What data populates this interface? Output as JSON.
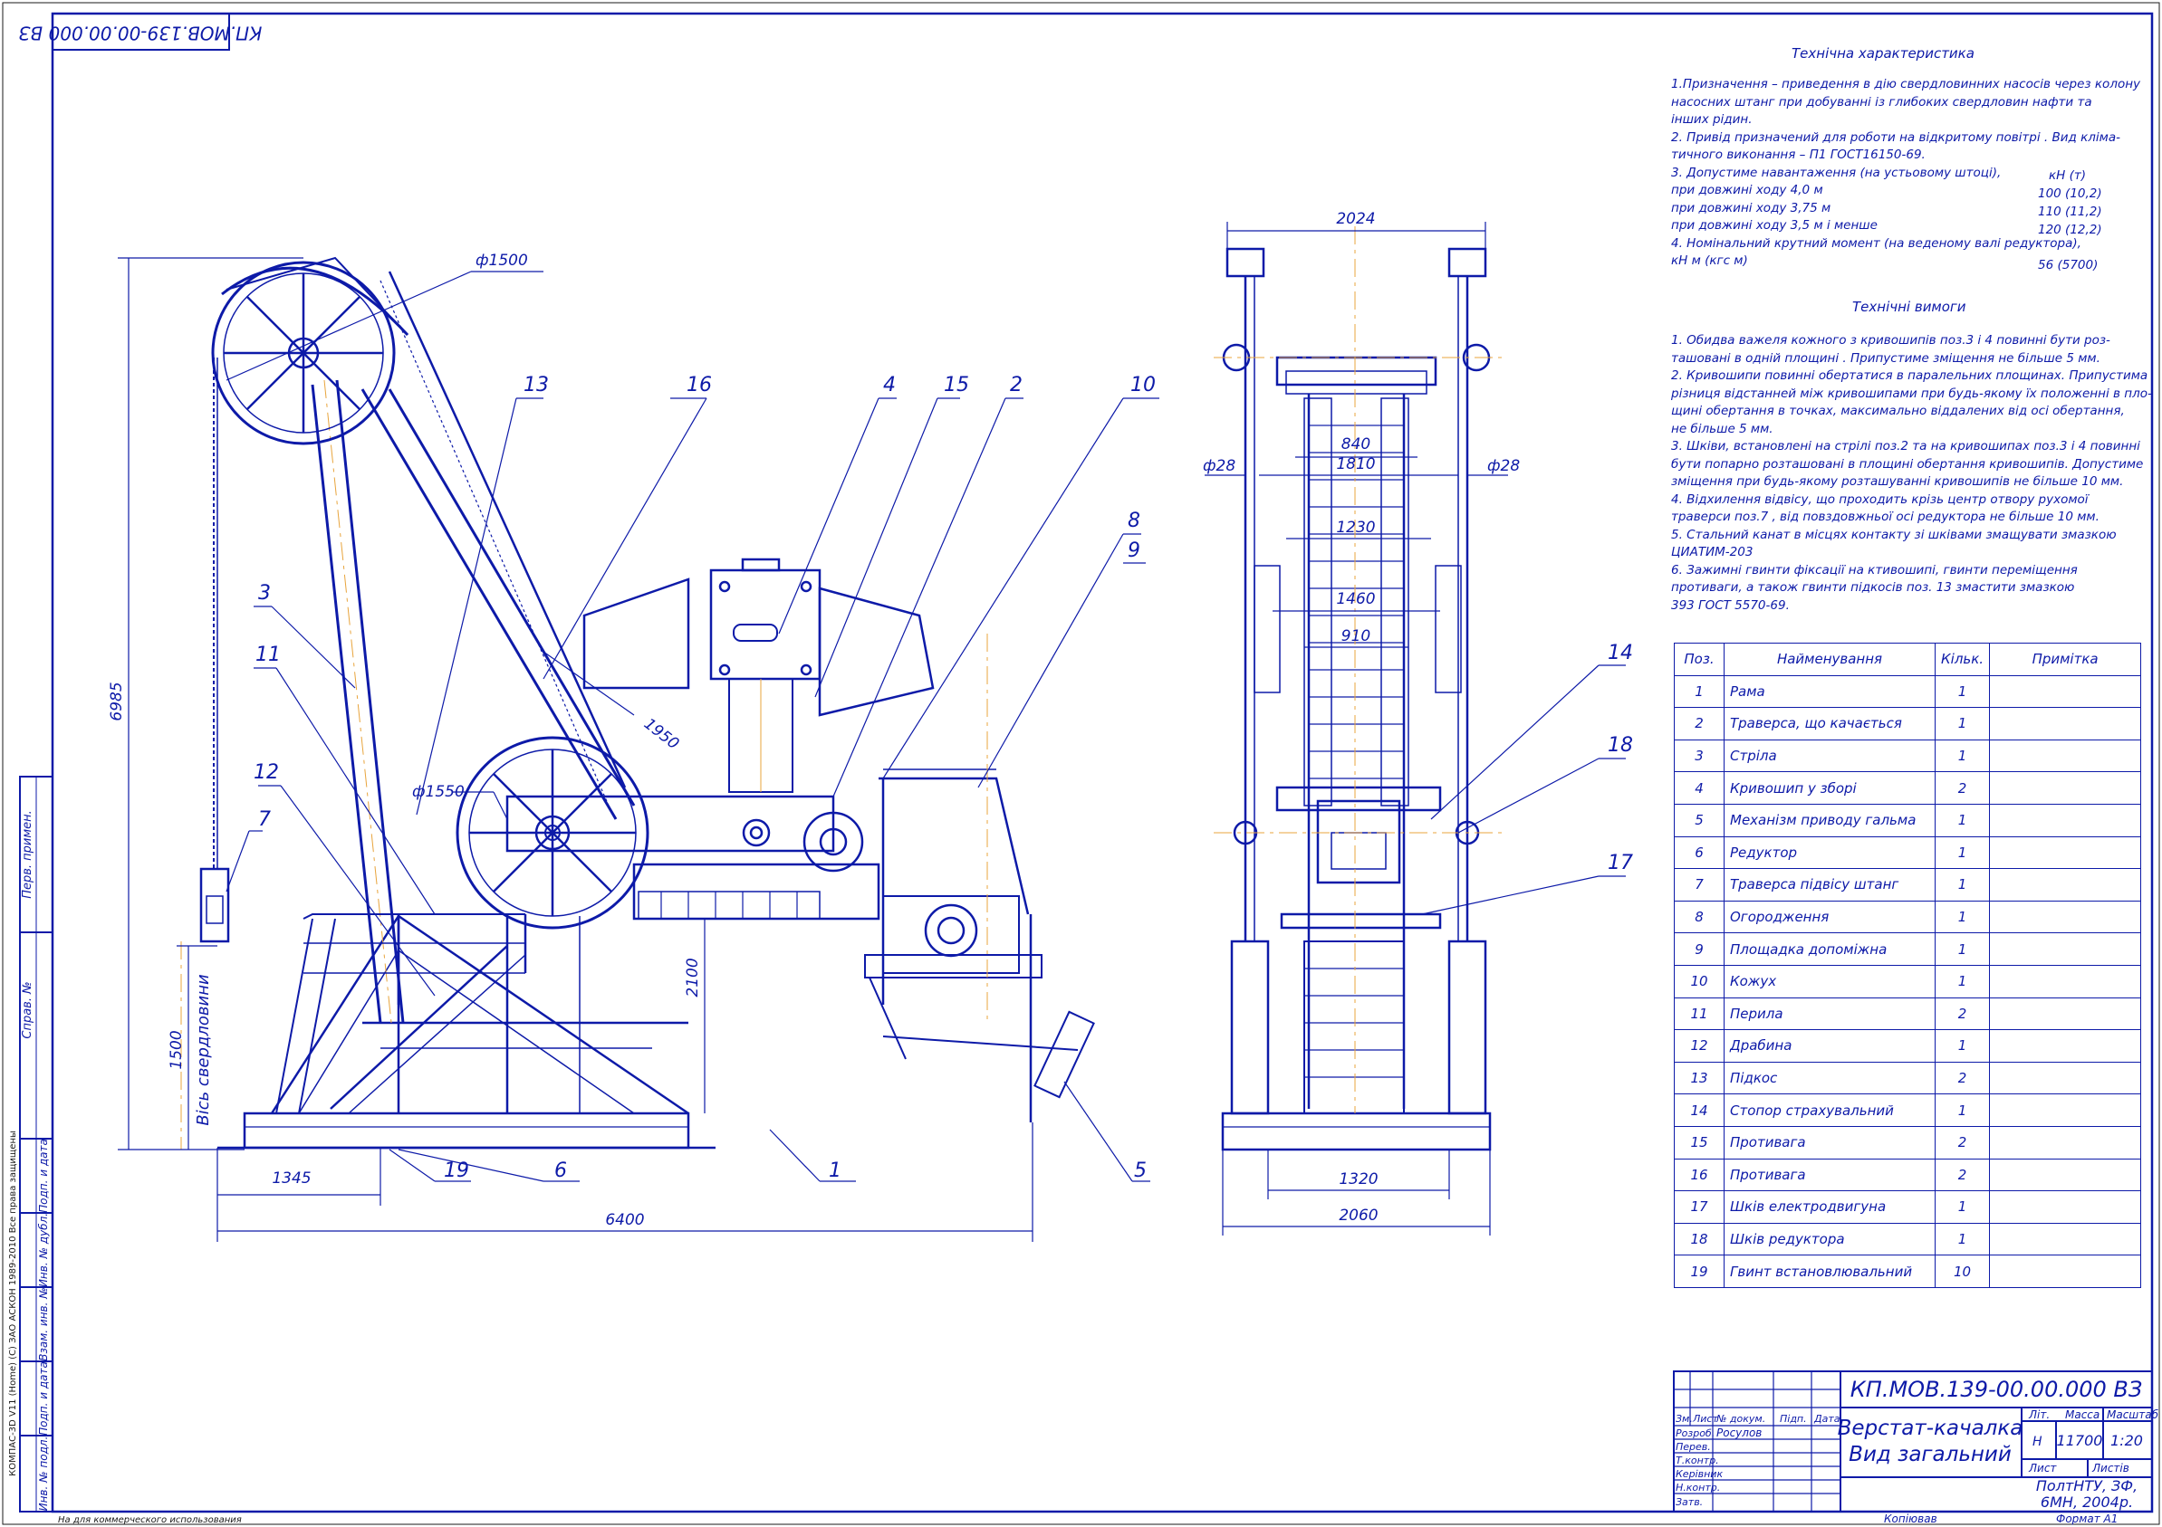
{
  "sheet_code_rotated": "КП.МОВ.139-00.00.000   ВЗ",
  "tech_char": {
    "title": "Технічна характеристика",
    "lines": [
      "1.Призначення – приведення в дію свердловинних насосів через колону",
      "насосних штанг при добуванні із глибоких свердловин нафти та",
      "інших рідин.",
      "2. Привід призначений для роботи на відкритому повітрі . Вид кліма-",
      "тичного виконання – П1 ГОСТ16150-69.",
      "3. Допустиме навантаження (на устьовому штоці),",
      "при довжині ходу 4,0 м",
      "при довжині ходу 3,75 м",
      "при довжині ходу 3,5 м і менше",
      "4. Номінальний крутний момент (на веденому валі редуктора),",
      "кН м (кгс м)"
    ],
    "unit_label": "кН (т)",
    "values": [
      "100 (10,2)",
      "110 (11,2)",
      "120 (12,2)",
      "56 (5700)"
    ]
  },
  "tech_req": {
    "title": "Технічні вимоги",
    "lines": [
      "1. Обидва важеля кожного з кривошипів поз.3 і 4 повинні бути роз-",
      "ташовані в одній площині . Припустиме зміщення не більше 5 мм.",
      "2. Кривошипи повинні обертатися в паралельних площинах. Припустима",
      "різниця відстанней між кривошипами при будь-якому їх положенні в пло-",
      "щині обертання в точках, максимально віддалених від осі обертання,",
      "не більше 5 мм.",
      "3. Шківи, встановлені на стрілі поз.2 та на кривошипах поз.3 і 4 повинні",
      "бути попарно розташовані в площині обертання кривошипів. Допустиме",
      "зміщення при будь-якому розташуванні кривошипів не більше 10 мм.",
      "4. Відхилення відвісу, що проходить крізь центр отвору рухомої",
      "траверси поз.7 , від повздовжньої осі редуктора не більше 10 мм.",
      "5. Стальний канат в місцях контакту зі шківами змащувати змазкою",
      "ЦИАТИМ-203",
      "6. Зажимні гвинти фіксації на ктивошипі, гвинти переміщення",
      "противаги, а також гвинти підкосів поз. 13 змастити змазкою",
      "393 ГОСТ 5570-69."
    ]
  },
  "spec_table": {
    "headers": [
      "Поз.",
      "Найменування",
      "Кільк.",
      "Примітка"
    ],
    "rows": [
      [
        "1",
        "Рама",
        "1",
        ""
      ],
      [
        "2",
        "Траверса, що качається",
        "1",
        ""
      ],
      [
        "3",
        "Стріла",
        "1",
        ""
      ],
      [
        "4",
        "Кривошип у зборі",
        "2",
        ""
      ],
      [
        "5",
        "Механізм приводу гальма",
        "1",
        ""
      ],
      [
        "6",
        "Редуктор",
        "1",
        ""
      ],
      [
        "7",
        "Траверса підвісу штанг",
        "1",
        ""
      ],
      [
        "8",
        "Огородження",
        "1",
        ""
      ],
      [
        "9",
        "Площадка допоміжна",
        "1",
        ""
      ],
      [
        "10",
        "Кожух",
        "1",
        ""
      ],
      [
        "11",
        "Перила",
        "2",
        ""
      ],
      [
        "12",
        "Драбина",
        "1",
        ""
      ],
      [
        "13",
        "Підкос",
        "2",
        ""
      ],
      [
        "14",
        "Стопор страхувальний",
        "1",
        ""
      ],
      [
        "15",
        "Противага",
        "2",
        ""
      ],
      [
        "16",
        "Противага",
        "2",
        ""
      ],
      [
        "17",
        "Шків електродвигуна",
        "1",
        ""
      ],
      [
        "18",
        "Шків редуктора",
        "1",
        ""
      ],
      [
        "19",
        "Гвинт встановлювальний",
        "10",
        ""
      ]
    ]
  },
  "title_block": {
    "code": "КП.МОВ.139-00.00.000   ВЗ",
    "name_line1": "Верстат-качалка",
    "name_line2": "Вид загальний",
    "col_labels": [
      "Зм.",
      "Лист",
      "№ докум.",
      "Підп.",
      "Дата"
    ],
    "row_labels": [
      "Розроб.",
      "Перев.",
      "Т.контр.",
      "Керівник",
      "Н.контр.",
      "Затв."
    ],
    "developer": "Росулов",
    "lit_label": "Літ.",
    "mass_label": "Масса",
    "scale_label": "Масштаб",
    "lit_value": "Н",
    "mass_value": "11700",
    "scale_value": "1:20",
    "sheet_label": "Лист",
    "sheets_label": "Листів",
    "org_line1": "ПолтНТУ, ЗФ,",
    "org_line2": "6МН, 2004р.",
    "copied": "Копіював",
    "format": "Формат    А1"
  },
  "side_stamps": [
    "Перв. примен.",
    "Справ. №",
    "Подп. и дата",
    "Инв. № дубл.",
    "Взам. инв. №",
    "Подп. и дата",
    "Инв. № подл."
  ],
  "footer_left": "На для коммерческого использования",
  "footer_software": "КОМПАС-3D V11 (Home) (С) ЗАО АСКОН 1989-2010 Все права защищены",
  "dimensions": {
    "d_1500": "ф1500",
    "d_1550": "ф1550",
    "d_6985": "6985",
    "d_1500v": "1500",
    "d_2100": "2100",
    "d_1950": "1950",
    "d_1345": "1345",
    "d_6400": "6400",
    "d_2024": "2024",
    "d_840": "840",
    "d_1810": "1810",
    "d_1230": "1230",
    "d_1460": "1460",
    "d_910": "910",
    "d_f28l": "ф28",
    "d_f28r": "ф28",
    "d_1320": "1320",
    "d_2060": "2060",
    "well_axis": "Вісь свердловини"
  },
  "callouts": [
    "1",
    "2",
    "3",
    "4",
    "5",
    "6",
    "7",
    "8",
    "9",
    "10",
    "11",
    "12",
    "13",
    "14",
    "15",
    "16",
    "17",
    "18",
    "19"
  ],
  "colors": {
    "line": "#0d1aa8",
    "accent": "#e8a43c",
    "text": "#0d1aa8"
  }
}
